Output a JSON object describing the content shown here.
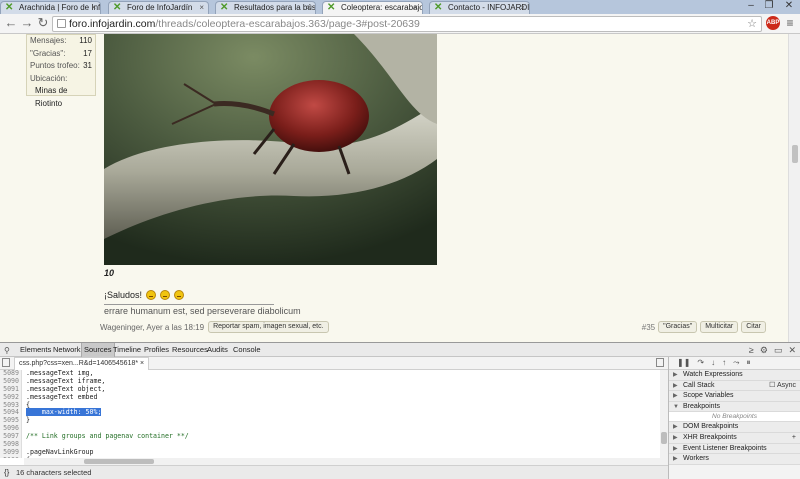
{
  "browser": {
    "tabs": [
      {
        "title": "Arachnida | Foro de Infojar",
        "active": false
      },
      {
        "title": "Foro de InfoJardín",
        "active": false
      },
      {
        "title": "Resultados para la búsque",
        "active": false
      },
      {
        "title": "Coleoptera: escarabajos | ",
        "active": true
      },
      {
        "title": "Contacto - INFOJARDIN.",
        "active": false
      }
    ],
    "url_host": "foro.infojardin.com",
    "url_path": "/threads/coleoptera-escarabajos.363/page-3#post-20639",
    "extension_label": "ABP",
    "colors": {
      "tabbar": "#b6c6dc",
      "favicon": "#4f9a2a"
    }
  },
  "post": {
    "user_stats": [
      {
        "label": "Mensajes:",
        "value": "110"
      },
      {
        "label": "\"Gracias\":",
        "value": "17"
      },
      {
        "label": "Puntos trofeo:",
        "value": "31"
      }
    ],
    "location_label": "Ubicación:",
    "location_value": "Minas de Riotinto",
    "image_number": "10",
    "greeting": "¡Saludos!",
    "signature": "errare humanum est, sed perseverare diabolicum",
    "author_time": "Wageninger, Ayer a las 18:19",
    "report_button": "Reportar spam, imagen sexual, etc.",
    "post_number": "#35",
    "thanks_button": "\"Gracias\"",
    "multiquote_button": "Multicitar",
    "quote_button": "Citar"
  },
  "devtools": {
    "tabs": [
      "Elements",
      "Network",
      "Sources",
      "Timeline",
      "Profiles",
      "Resources",
      "Audits",
      "Console"
    ],
    "active_tab": "Sources",
    "file_tab": "css.php?css=xen...R&d=1406545618* ×",
    "line_numbers": [
      "5089",
      "5090",
      "5091",
      "5092",
      "5093",
      "5094",
      "5095",
      "5096",
      "5097",
      "5098",
      "5099",
      "5100",
      "5101"
    ],
    "code_lines": [
      ".messageText img,",
      ".messageText iframe,",
      ".messageText object,",
      ".messageText embed",
      "{",
      "    max-width: 50%;",
      "}",
      "",
      "/** Link groups and pagenav container **/",
      "",
      ".pageNavLinkGroup",
      "{",
      ""
    ],
    "selected_line_index": 5,
    "comment_line_index": 8,
    "status": "16 characters selected",
    "sidebar": {
      "watch_expressions": "Watch Expressions",
      "call_stack": "Call Stack",
      "async_label": "Async",
      "scope_variables": "Scope Variables",
      "breakpoints": "Breakpoints",
      "no_breakpoints": "No Breakpoints",
      "dom_breakpoints": "DOM Breakpoints",
      "xhr_breakpoints": "XHR Breakpoints",
      "event_listener_breakpoints": "Event Listener Breakpoints",
      "workers": "Workers"
    }
  }
}
